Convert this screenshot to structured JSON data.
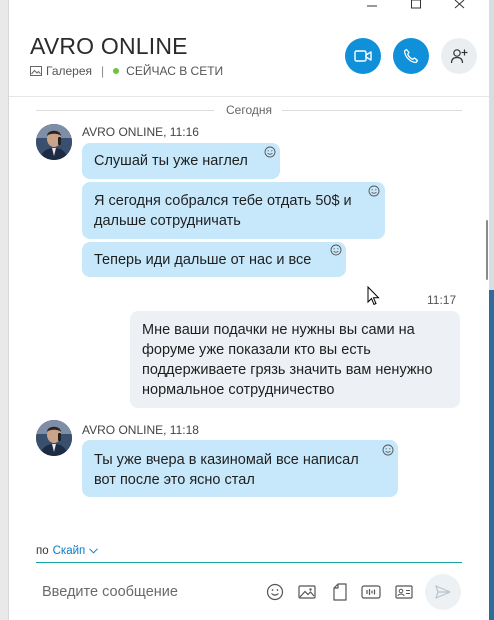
{
  "contact": {
    "name": "AVRO ONLINE",
    "gallery_label": "Галерея",
    "separator": "|",
    "status": "СЕЙЧАС В СЕТИ"
  },
  "date_divider": "Сегодня",
  "messages": [
    {
      "direction": "incoming",
      "sender": "AVRO ONLINE, 11:16",
      "bubbles": [
        [
          "Слушай ты уже наглел"
        ],
        [
          "Я сегодня собрался тебе отдать 50$ и",
          "дальше сотрудничать"
        ],
        [
          "Теперь иди дальше от нас и все"
        ]
      ]
    },
    {
      "direction": "outgoing",
      "time": "11:17",
      "bubbles": [
        [
          "Мне ваши подачки не нужны  вы сами на",
          "форуме  уже показали кто вы есть",
          "поддерживаете грязь значить вам  ненужно",
          "нормальное сотрудничество"
        ]
      ]
    },
    {
      "direction": "incoming",
      "sender": "AVRO ONLINE, 11:18",
      "bubbles": [
        [
          "Ты уже вчера в казиномай все написал",
          "вот после это ясно стал"
        ]
      ]
    }
  ],
  "compose": {
    "via_label": "по",
    "service": "Скайп",
    "placeholder": "Введите сообщение"
  },
  "icons": {
    "video": "video-call-icon",
    "call": "phone-icon",
    "add": "add-person-icon",
    "emoji": "emoji-icon",
    "image": "image-icon",
    "file": "file-icon",
    "audio": "audio-message-icon",
    "contact_card": "contact-card-icon",
    "send": "send-icon"
  },
  "colors": {
    "accent": "#0f90d8",
    "incoming_bubble": "#c7e8fb",
    "outgoing_bubble": "#edf0f4",
    "online": "#6bc33e",
    "compose_line": "#18a0a0"
  }
}
